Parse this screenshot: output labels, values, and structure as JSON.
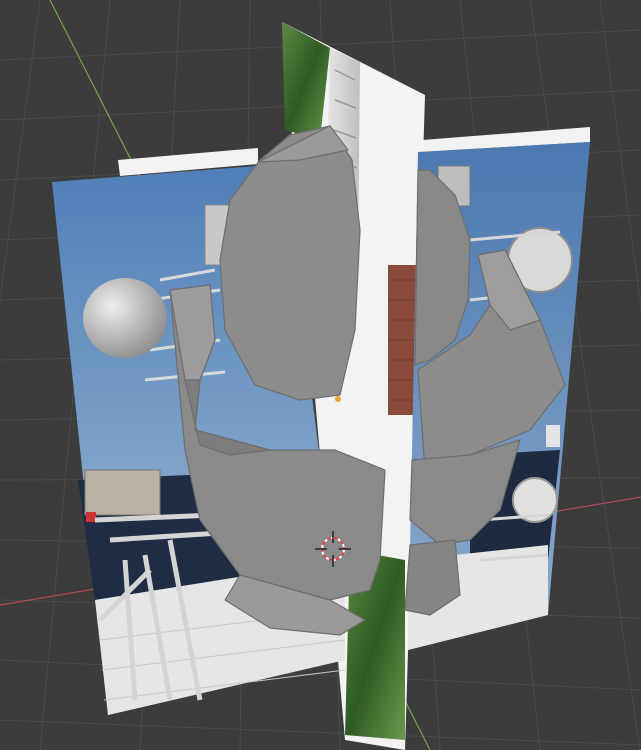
{
  "viewport": {
    "background": "#3c3c3c",
    "grid_color": "#4b4b4b",
    "axis_x_color": "#b84a4a",
    "axis_y_color": "#7aa33a"
  },
  "scene": {
    "reference_images": [
      "photo-plane-left",
      "photo-plane-center",
      "photo-plane-right"
    ],
    "model_color": "#8c8c8c",
    "model_edge_color": "#6e6e6e",
    "sky_color": "#5b86b8",
    "sea_color": "#1d2a40",
    "foliage_color": "#3f6a2c"
  },
  "cursor": {
    "icon": "3d-cursor-icon"
  }
}
